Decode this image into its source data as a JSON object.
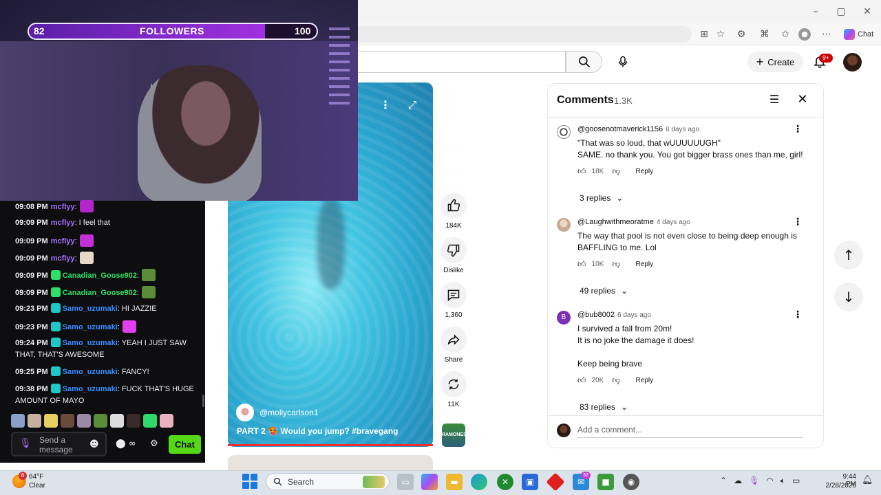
{
  "stream": {
    "follow_goal": {
      "current": "82",
      "label": "FOLLOWERS",
      "goal": "100",
      "progress_fraction": 0.82
    }
  },
  "chat": {
    "messages": [
      {
        "time": "09:08 PM",
        "user": "mcflyy",
        "sep": ":",
        "text": "",
        "user_color": "#a970ff",
        "has_emote": true,
        "emote_color": "#b326c9"
      },
      {
        "time": "09:09 PM",
        "user": "mcflyy",
        "sep": ":",
        "text": " I feel that",
        "user_color": "#a970ff"
      },
      {
        "time": "09:09 PM",
        "user": "mcflyy",
        "sep": ":",
        "text": "",
        "user_color": "#a970ff",
        "has_emote": true,
        "emote_color": "#c42fd8"
      },
      {
        "time": "09:09 PM",
        "user": "mcflyy",
        "sep": ":",
        "text": "",
        "user_color": "#a970ff",
        "has_emote": true,
        "emote_color": "#e8d8c8"
      },
      {
        "time": "09:09 PM",
        "user": "Canadian_Goose902",
        "sep": ":",
        "text": "",
        "user_color": "#2ee06a",
        "has_badge": true,
        "badge_color": "#2ee06a",
        "has_emote": true,
        "emote_color": "#5a8c3a"
      },
      {
        "time": "09:09 PM",
        "user": "Canadian_Goose902",
        "sep": ":",
        "text": "",
        "user_color": "#2ee06a",
        "has_badge": true,
        "badge_color": "#2ee06a",
        "has_emote": true,
        "emote_color": "#5a8c3a"
      },
      {
        "time": "09:23 PM",
        "user": "Samo_uzumaki",
        "sep": ":",
        "text": " HI JAZZIE",
        "user_color": "#3a8bff",
        "has_badge": true,
        "badge_color": "#1fc7c7"
      },
      {
        "time": "09:23 PM",
        "user": "Samo_uzumaki",
        "sep": ":",
        "text": "",
        "user_color": "#3a8bff",
        "has_badge": true,
        "badge_color": "#1fc7c7",
        "has_emote": true,
        "emote_color": "#e040f0"
      },
      {
        "time": "09:24 PM",
        "user": "Samo_uzumaki",
        "sep": ":",
        "text": " YEAH I JUST SAW THAT, THAT'S AWESOME",
        "user_color": "#3a8bff",
        "has_badge": true,
        "badge_color": "#1fc7c7"
      },
      {
        "time": "09:25 PM",
        "user": "Samo_uzumaki",
        "sep": ":",
        "text": " FANCY!",
        "user_color": "#3a8bff",
        "has_badge": true,
        "badge_color": "#1fc7c7"
      },
      {
        "time": "09:38 PM",
        "user": "Samo_uzumaki",
        "sep": ":",
        "text": " FUCK THAT'S HUGE AMOUNT OF MAYO",
        "user_color": "#3a8bff",
        "has_badge": true,
        "badge_color": "#1fc7c7"
      }
    ],
    "input_placeholder": "Send a message",
    "send_label": "Chat",
    "points_label": "∞"
  },
  "browser": {
    "edge_chat_label": "Chat"
  },
  "youtube": {
    "create_label": "Create",
    "notif_badge": "9+",
    "video": {
      "channel": "@mollycarlson1",
      "title": "PART 2 🥵 Would you jump? #bravegang"
    },
    "actions": {
      "likes": "184K",
      "dislike_label": "Dislike",
      "comments": "1,360",
      "share_label": "Share",
      "remix": "11K",
      "sound_label": "RAMONES"
    },
    "comments_panel": {
      "title": "Comments",
      "count": "1.3K",
      "add_placeholder": "Add a comment...",
      "items": [
        {
          "handle": "@goosenotmaverick1156",
          "time": "6 days ago",
          "lines": [
            "\"That was so loud, that wUUUUUUGH\"",
            "SAME. no thank you. You got bigger brass ones than me, girl!"
          ],
          "likes": "18K",
          "reply_label": "Reply",
          "replies": "3 replies"
        },
        {
          "handle": "@Laughwithmeoratme",
          "time": "4 days ago",
          "lines": [
            "The way that pool is not even close to being deep enough is",
            "BAFFLING to me. Lol"
          ],
          "likes": "10K",
          "reply_label": "Reply",
          "replies": "49 replies"
        },
        {
          "handle": "@bub8002",
          "time": "6 days ago",
          "avatar_letter": "B",
          "lines": [
            "I survived a fall from 20m!",
            "It is no joke the damage it does!",
            "",
            "Keep being brave"
          ],
          "likes": "20K",
          "reply_label": "Reply",
          "replies": "83 replies"
        }
      ]
    }
  },
  "taskbar": {
    "weather_temp": "64°F",
    "weather_cond": "Clear",
    "weather_badge": "6",
    "search_label": "Search",
    "app_badge": "32",
    "time": "9:44 PM",
    "date": "2/28/2026"
  },
  "colors": {
    "twitch_chat_bg": "#0e0e10",
    "twitch_send_button": "#55d816",
    "follow_bar_fill": "#a030e0",
    "yt_notif_badge": "#cc0000"
  }
}
